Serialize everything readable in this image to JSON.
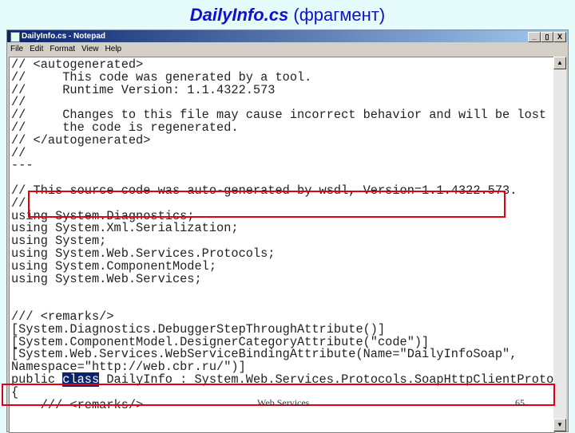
{
  "slide": {
    "title_file": "DailyInfo.cs",
    "title_suffix": " (фрагмент)",
    "footer": "Web Services",
    "page_number": "65"
  },
  "window": {
    "title": "DailyInfo.cs - Notepad",
    "buttons": [
      "_",
      "▯",
      "X"
    ]
  },
  "menu": [
    "File",
    "Edit",
    "Format",
    "View",
    "Help"
  ],
  "code": {
    "lines_before": [
      "// <autogenerated>",
      "//     This code was generated by a tool.",
      "//     Runtime Version: 1.1.4322.573",
      "//",
      "//     Changes to this file may cause incorrect behavior and will be lost if",
      "//     the code is regenerated.",
      "// </autogenerated>",
      "//",
      "---",
      "",
      "//"
    ],
    "highlight_line": "This source code was auto-generated by wsdl, Version=1.1.4322.573.",
    "lines_mid": [
      "//",
      "using System.Diagnostics;",
      "using System.Xml.Serialization;",
      "using System;",
      "using System.Web.Services.Protocols;",
      "using System.ComponentModel;",
      "using System.Web.Services;",
      "",
      "",
      "/// <remarks/>",
      "[System.Diagnostics.DebuggerStepThroughAttribute()]",
      "[System.ComponentModel.DesignerCategoryAttribute(\"code\")]",
      "[System.Web.Services.WebServiceBindingAttribute(Name=\"DailyInfoSoap\",",
      "Namespace=\"http://web.cbr.ru/\")]"
    ],
    "class_pre": "public ",
    "class_sel": "class",
    "class_post": " DailyInfo : System.Web.Services.Protocols.SoapHttpClientProtocol",
    "lines_after": [
      "{",
      "    /// <remarks/>"
    ]
  },
  "colors": {
    "highlight_box": "#e00010",
    "title": "#1010d0",
    "selection": "#0a246a"
  }
}
